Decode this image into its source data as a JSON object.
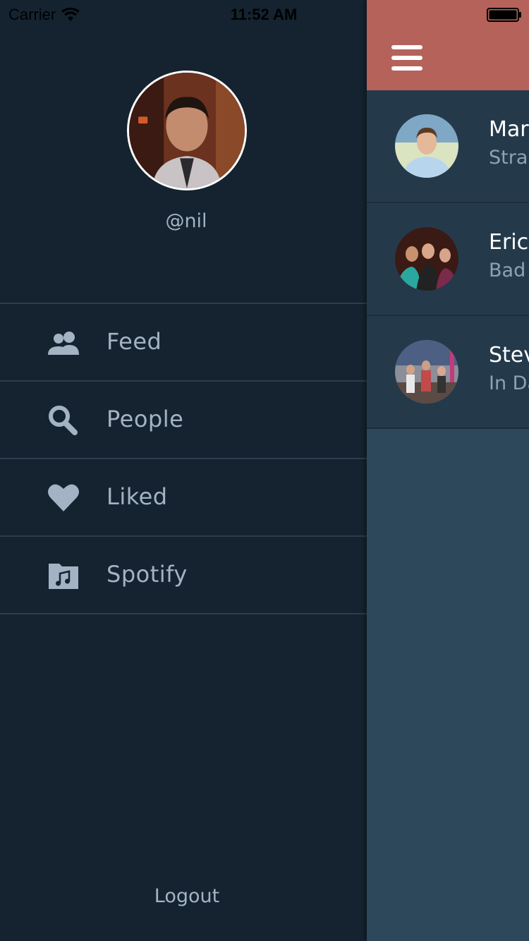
{
  "status_bar": {
    "carrier": "Carrier",
    "time": "11:52 AM"
  },
  "drawer": {
    "username": "@nil",
    "menu": [
      {
        "label": "Feed",
        "icon": "people-group-icon"
      },
      {
        "label": "People",
        "icon": "search-icon"
      },
      {
        "label": "Liked",
        "icon": "heart-icon"
      },
      {
        "label": "Spotify",
        "icon": "music-folder-icon"
      }
    ],
    "logout_label": "Logout"
  },
  "feed": {
    "items": [
      {
        "name": "Mar",
        "subtitle": "Stran"
      },
      {
        "name": "Eric",
        "subtitle": "Bad"
      },
      {
        "name": "Stev",
        "subtitle": "In Da"
      }
    ]
  },
  "colors": {
    "drawer_bg": "#14232f",
    "menu_text": "#a4b3c4",
    "navbar": "#b5625a",
    "feed_row_bg": "#243a4b",
    "content_bg": "#2e485b"
  }
}
